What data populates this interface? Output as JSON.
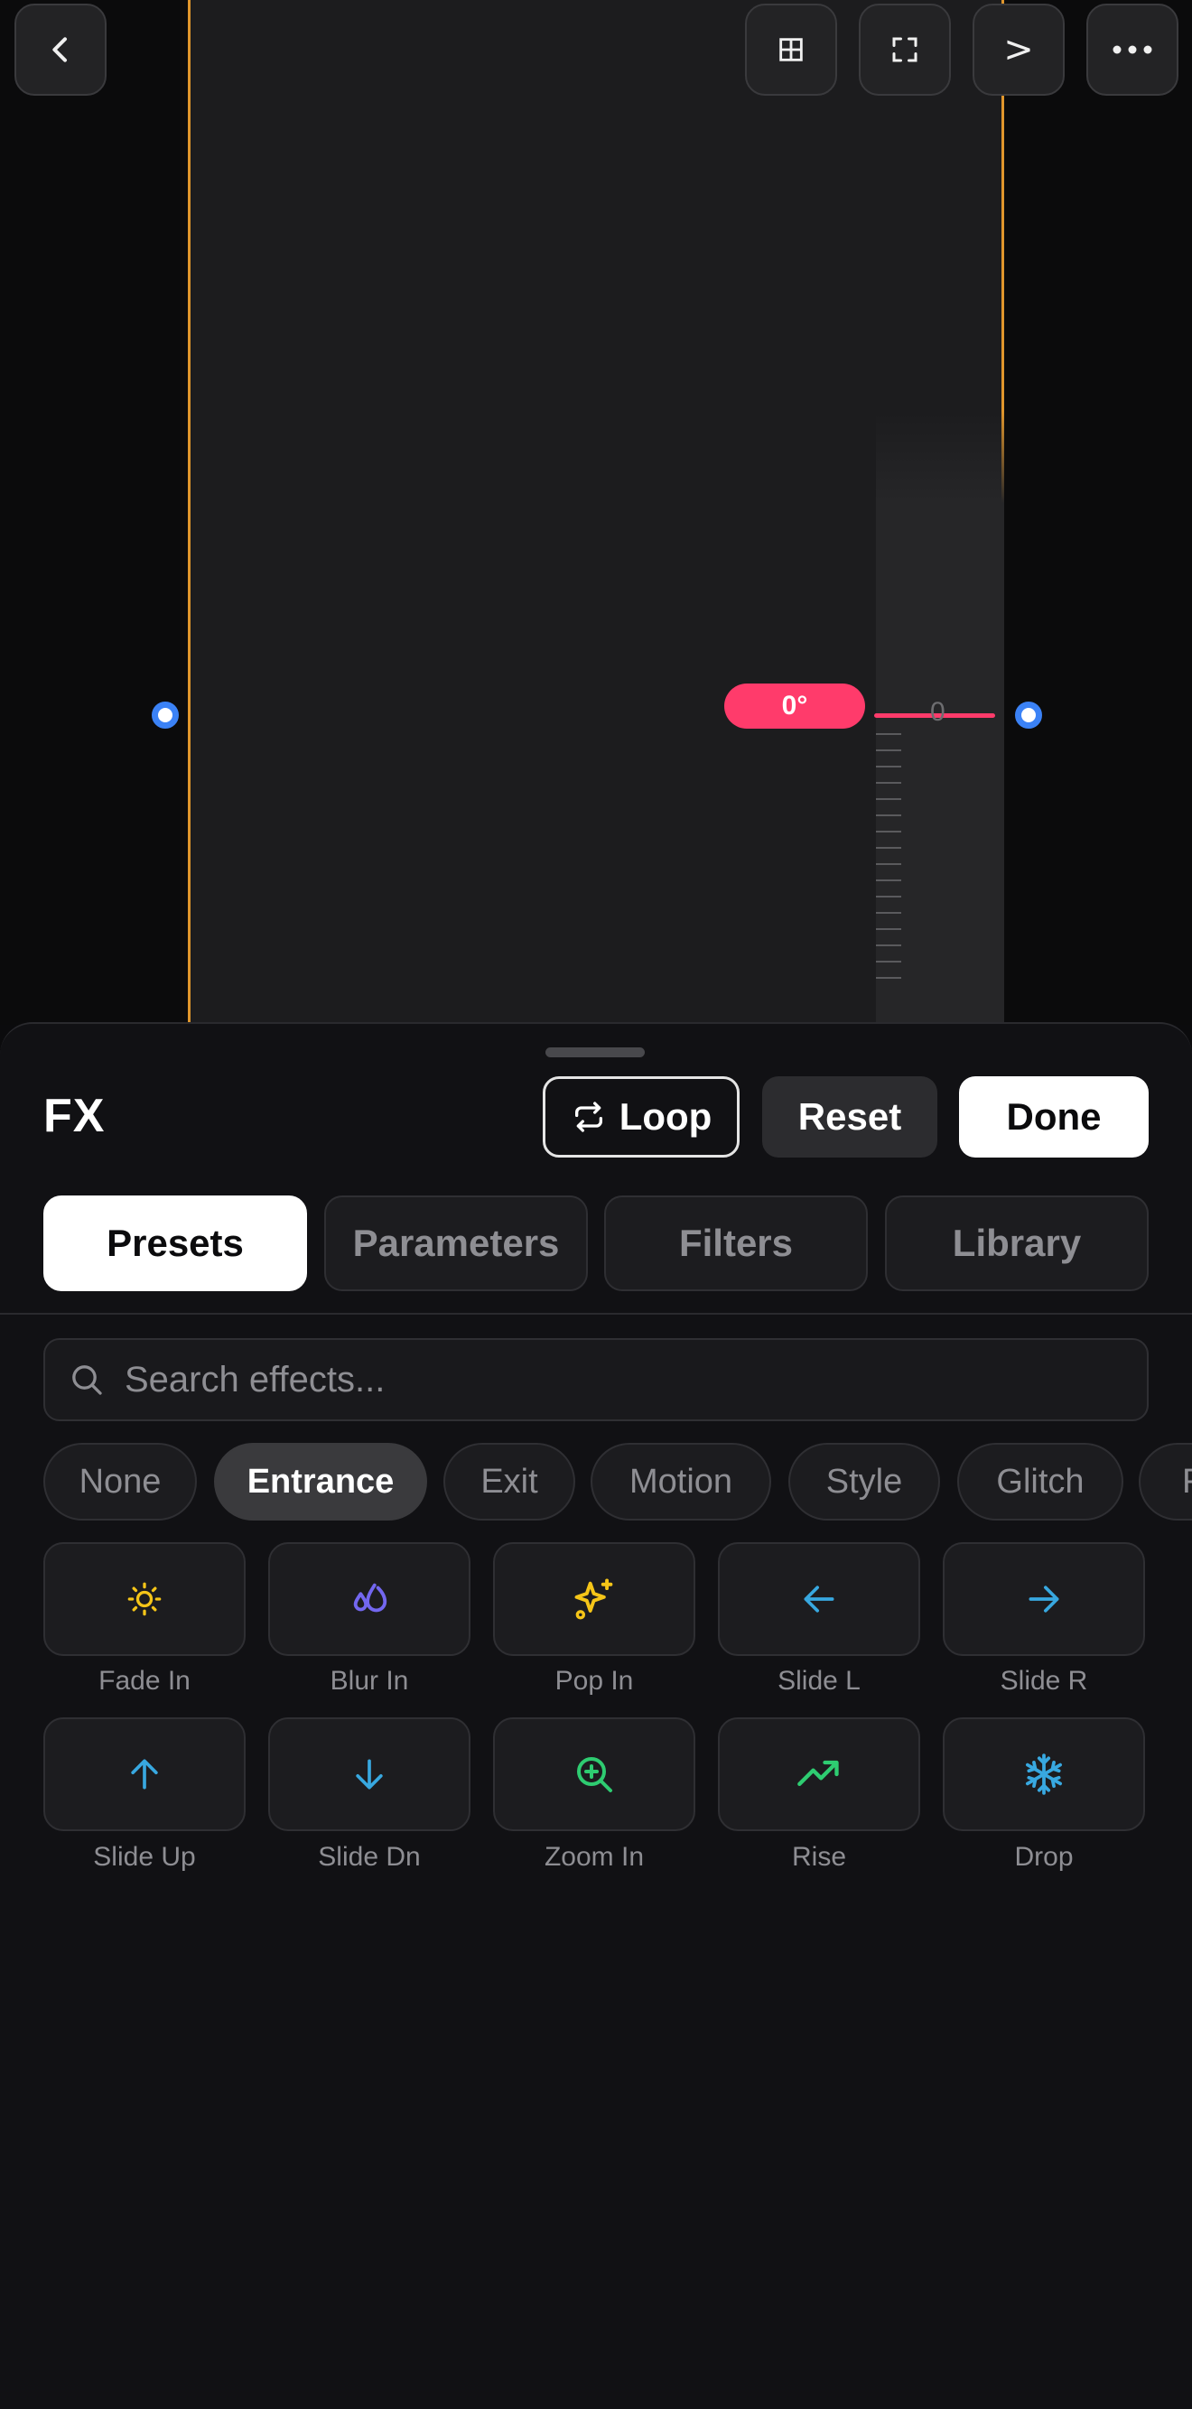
{
  "toolbar": {
    "back_icon": "chevron-left-icon",
    "grid_icon": "grid-icon",
    "fullscreen_icon": "fullscreen-icon",
    "next_label": ">",
    "more_icon": "more-horizontal-icon"
  },
  "canvas": {
    "angle_value": "0°",
    "ruler_zero": "0",
    "frame_color": "#e0962c",
    "accent_color": "#ff3b6b"
  },
  "sheet": {
    "title": "FX",
    "loop_label": "Loop",
    "reset_label": "Reset",
    "done_label": "Done"
  },
  "tabs": [
    {
      "label": "Presets",
      "active": true
    },
    {
      "label": "Parameters",
      "active": false
    },
    {
      "label": "Filters",
      "active": false
    },
    {
      "label": "Library",
      "active": false
    }
  ],
  "search": {
    "placeholder": "Search effects..."
  },
  "categories": [
    {
      "label": "None",
      "active": false
    },
    {
      "label": "Entrance",
      "active": true
    },
    {
      "label": "Exit",
      "active": false
    },
    {
      "label": "Motion",
      "active": false
    },
    {
      "label": "Style",
      "active": false
    },
    {
      "label": "Glitch",
      "active": false
    },
    {
      "label": "F",
      "active": false
    }
  ],
  "effects": [
    {
      "label": "Fade In",
      "icon": "sun-icon",
      "color": "#f5c518"
    },
    {
      "label": "Blur In",
      "icon": "droplets-icon",
      "color": "#7367f0"
    },
    {
      "label": "Pop In",
      "icon": "sparkles-icon",
      "color": "#f5c518"
    },
    {
      "label": "Slide L",
      "icon": "arrow-left-icon",
      "color": "#38a8e0"
    },
    {
      "label": "Slide R",
      "icon": "arrow-right-icon",
      "color": "#38a8e0"
    },
    {
      "label": "Slide Up",
      "icon": "arrow-up-icon",
      "color": "#38a8e0"
    },
    {
      "label": "Slide Dn",
      "icon": "arrow-down-icon",
      "color": "#38a8e0"
    },
    {
      "label": "Zoom In",
      "icon": "zoom-in-icon",
      "color": "#2ecc71"
    },
    {
      "label": "Rise",
      "icon": "trending-up-icon",
      "color": "#2ecc71"
    },
    {
      "label": "Drop",
      "icon": "snowflake-icon",
      "color": "#38a8e0"
    }
  ]
}
